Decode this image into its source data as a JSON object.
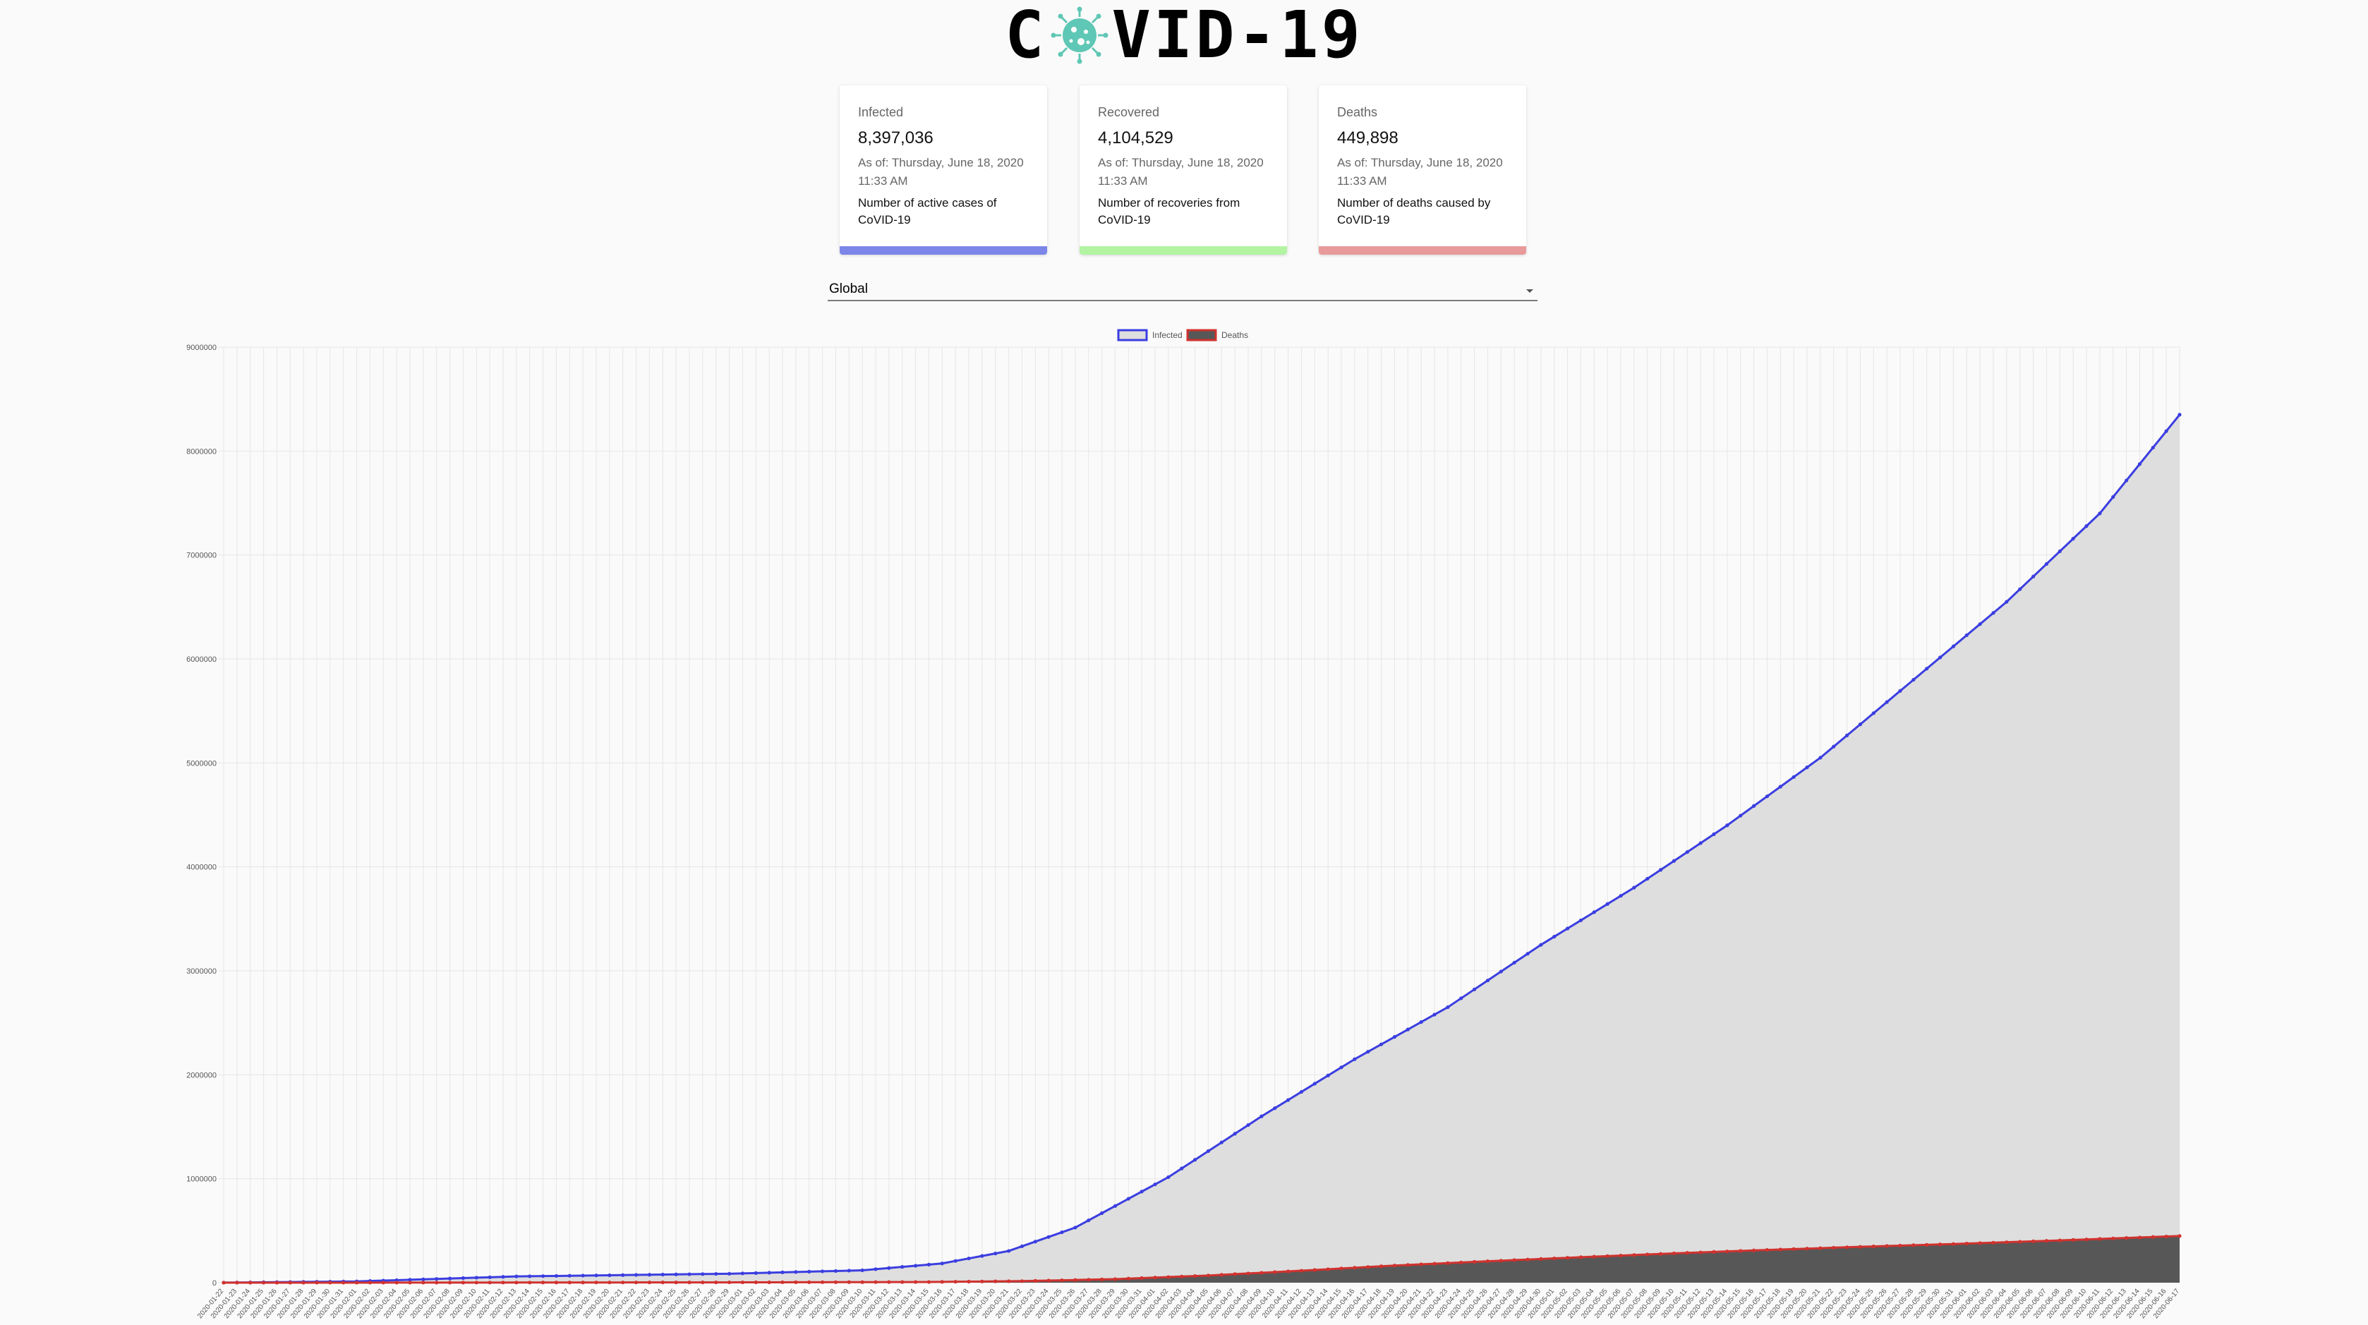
{
  "header": {
    "title_left": "C",
    "title_right": "VID-19",
    "logo_icon": "virus-icon",
    "logo_color": "#5fc7b5"
  },
  "cards": [
    {
      "title": "Infected",
      "value": "8,397,036",
      "date": "As of: Thursday, June 18, 2020 11:33 AM",
      "description": "Number of active cases of CoVID-19",
      "color": "#7b86e8"
    },
    {
      "title": "Recovered",
      "value": "4,104,529",
      "date": "As of: Thursday, June 18, 2020 11:33 AM",
      "description": "Number of recoveries from CoVID-19",
      "color": "#b2f4a2"
    },
    {
      "title": "Deaths",
      "value": "449,898",
      "date": "As of: Thursday, June 18, 2020 11:33 AM",
      "description": "Number of deaths caused by CoVID-19",
      "color": "#e89a9a"
    }
  ],
  "region_select": {
    "value": "Global"
  },
  "chart_data": {
    "type": "line",
    "legend_position": "top-center",
    "grid": true,
    "ylim": [
      0,
      9000000
    ],
    "y_ticks": [
      "0",
      "1000000",
      "2000000",
      "3000000",
      "4000000",
      "5000000",
      "6000000",
      "7000000",
      "8000000",
      "9000000"
    ],
    "x_start": "2020-01-22",
    "x_end": "2020-06-17",
    "x_count": 148,
    "x_step_days": 1,
    "series": [
      {
        "name": "Infected",
        "line_color": "#3b3ee0",
        "fill_color": "#dedede",
        "anchors": [
          [
            "2020-01-22",
            555
          ],
          [
            "2020-02-01",
            12000
          ],
          [
            "2020-02-13",
            60000
          ],
          [
            "2020-02-29",
            86000
          ],
          [
            "2020-03-10",
            119000
          ],
          [
            "2020-03-16",
            185000
          ],
          [
            "2020-03-21",
            305000
          ],
          [
            "2020-03-26",
            530000
          ],
          [
            "2020-04-02",
            1015000
          ],
          [
            "2020-04-09",
            1600000
          ],
          [
            "2020-04-16",
            2150000
          ],
          [
            "2020-04-23",
            2650000
          ],
          [
            "2020-04-30",
            3250000
          ],
          [
            "2020-05-07",
            3800000
          ],
          [
            "2020-05-14",
            4400000
          ],
          [
            "2020-05-21",
            5050000
          ],
          [
            "2020-05-28",
            5800000
          ],
          [
            "2020-06-04",
            6550000
          ],
          [
            "2020-06-11",
            7400000
          ],
          [
            "2020-06-17",
            8350000
          ]
        ]
      },
      {
        "name": "Deaths",
        "line_color": "#d0322e",
        "fill_color": "#575757",
        "anchors": [
          [
            "2020-01-22",
            17
          ],
          [
            "2020-02-01",
            260
          ],
          [
            "2020-02-15",
            1500
          ],
          [
            "2020-03-01",
            3000
          ],
          [
            "2020-03-15",
            6500
          ],
          [
            "2020-03-22",
            15000
          ],
          [
            "2020-03-29",
            34000
          ],
          [
            "2020-04-05",
            69000
          ],
          [
            "2020-04-12",
            115000
          ],
          [
            "2020-04-19",
            165000
          ],
          [
            "2020-04-26",
            206000
          ],
          [
            "2020-05-03",
            245000
          ],
          [
            "2020-05-10",
            282000
          ],
          [
            "2020-05-17",
            315000
          ],
          [
            "2020-05-24",
            345000
          ],
          [
            "2020-05-31",
            372000
          ],
          [
            "2020-06-07",
            402000
          ],
          [
            "2020-06-17",
            449000
          ]
        ]
      }
    ]
  }
}
